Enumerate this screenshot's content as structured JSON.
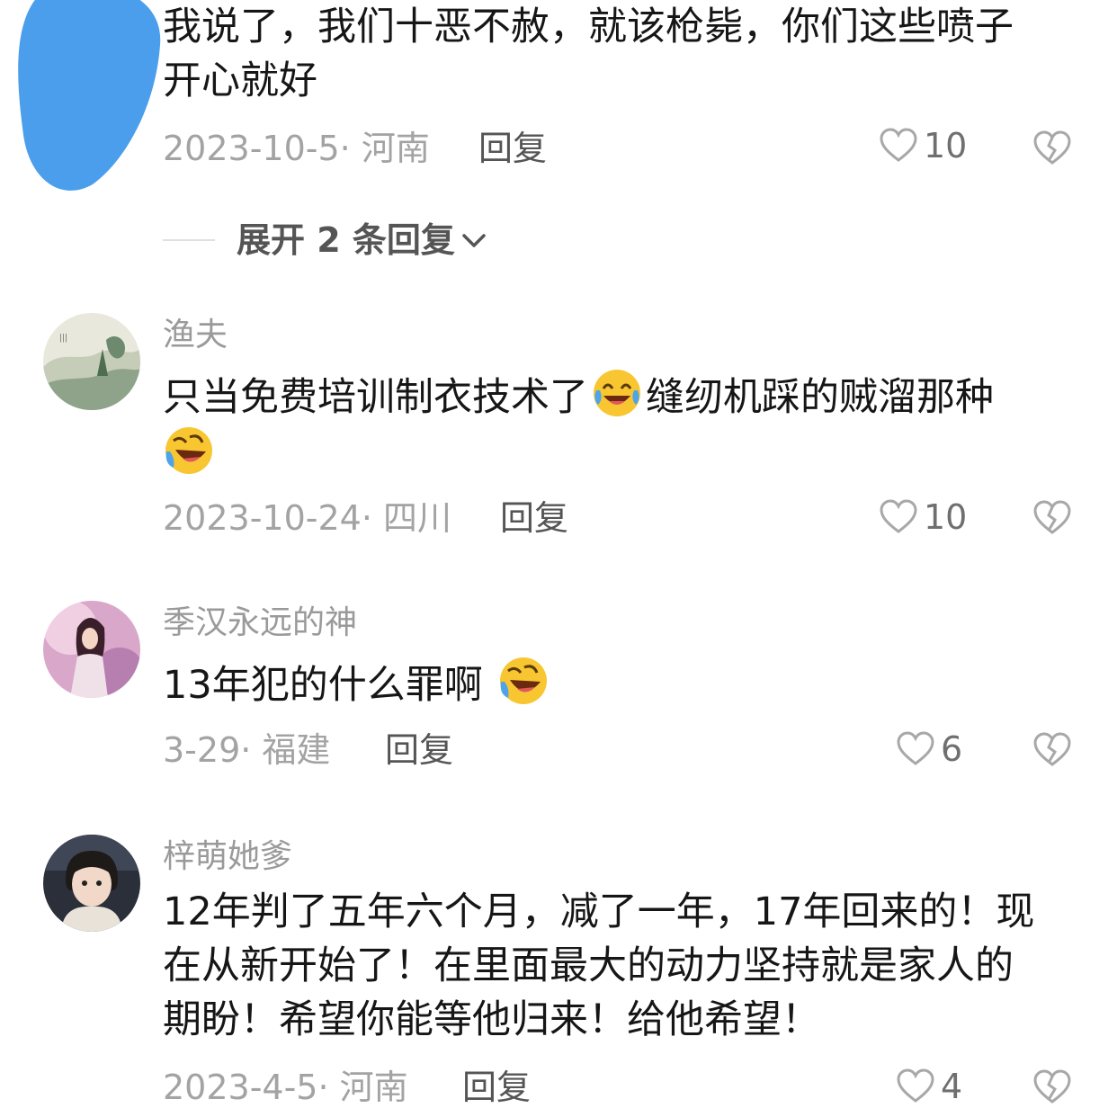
{
  "comments": [
    {
      "lines": [
        "我说了，我们十恶不赦，就该枪毙，你们这些喷子",
        "开心就好"
      ],
      "meta": "2023-10-5· 河南",
      "reply_label": "回复",
      "likes": "10"
    },
    {
      "username": "渔夫",
      "line1_a": "只当免费培训制衣技术了",
      "line1_b": "缝纫机踩的贼溜那种",
      "meta": "2023-10-24· 四川",
      "reply_label": "回复",
      "likes": "10"
    },
    {
      "username": "季汉永远的神",
      "line1": "13年犯的什么罪啊",
      "meta": "3-29· 福建",
      "reply_label": "回复",
      "likes": "6"
    },
    {
      "username": "梓萌她爹",
      "lines": [
        "12年判了五年六个月，减了一年，17年回来的！现",
        "在从新开始了！在里面最大的动力坚持就是家人的",
        "期盼！希望你能等他归来！给他希望！"
      ],
      "meta": "2023-4-5· 河南",
      "reply_label": "回复",
      "likes": "4"
    }
  ],
  "expand_replies_label": "展开 2 条回复",
  "icons": {
    "like": "heart-outline-icon",
    "dislike": "broken-heart-icon",
    "expand": "chevron-down-icon",
    "emoji_1": "tears-of-joy-emoji",
    "emoji_2": "rolling-laughing-emoji"
  },
  "colors": {
    "redaction_blob": "#4a9eec",
    "text": "#161616",
    "secondary": "#9a9a9a"
  }
}
